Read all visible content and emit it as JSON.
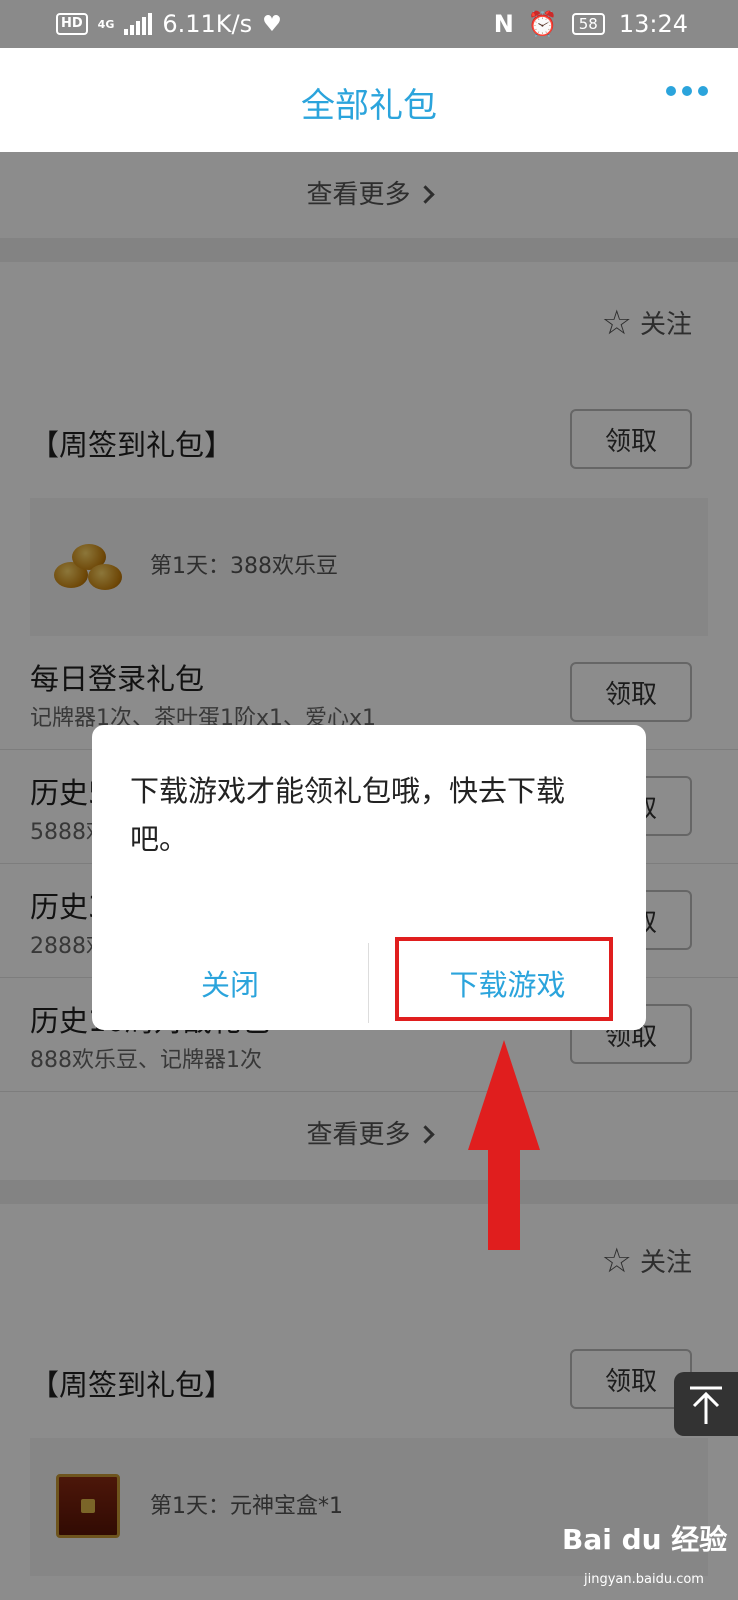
{
  "status_bar": {
    "hd": "HD",
    "net": "4G",
    "speed": "6.11K/s",
    "battery": "58",
    "time": "13:24"
  },
  "nav": {
    "title": "全部礼包"
  },
  "sections": [
    {
      "see_more_label": "查看更多"
    },
    {
      "follow_label": "关注",
      "weekly_title": "【周签到礼包】",
      "weekly_claim": "领取",
      "weekly_gift": "第1天：388欢乐豆",
      "rows": [
        {
          "name": "每日登录礼包",
          "desc": "记牌器1次、茶叶蛋1阶x1、爱心x1",
          "claim": "领取"
        },
        {
          "name": "历史50局对战礼包",
          "desc": "5888欢乐豆、大闸蟹4阶x1",
          "claim": "领取"
        },
        {
          "name": "历史30局对战礼包",
          "desc": "2888欢乐豆、记牌器x1",
          "claim": "领取"
        },
        {
          "name": "历史10局对战礼包",
          "desc": "888欢乐豆、记牌器1次",
          "claim": "领取"
        }
      ],
      "see_more_label": "查看更多"
    },
    {
      "follow_label": "关注",
      "weekly_title": "【周签到礼包】",
      "weekly_claim": "领取",
      "weekly_gift": "第1天：元神宝盒*1"
    }
  ],
  "dialog": {
    "message": "下载游戏才能领礼包哦，快去下载吧。",
    "close_label": "关闭",
    "download_label": "下载游戏"
  },
  "watermark": {
    "brand": "Bai du 经验",
    "url": "jingyan.baidu.com"
  },
  "colors": {
    "accent": "#2ba4dc",
    "highlight": "#e01e1e",
    "overlay": "rgba(0,0,0,0.45)"
  }
}
